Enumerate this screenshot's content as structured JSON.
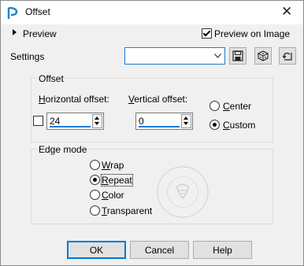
{
  "window": {
    "title": "Offset",
    "close_glyph": "✕"
  },
  "top": {
    "preview_label": "Preview",
    "preview_on_image_label": "Preview on Image",
    "preview_on_image_checked": true,
    "settings_label": "Settings",
    "settings_value": ""
  },
  "offset": {
    "group_title": "Offset",
    "horizontal_label_ul": "H",
    "horizontal_label_rest": "orizontal offset:",
    "vertical_label_ul": "V",
    "vertical_label_rest": "ertical offset:",
    "horizontal_value": "24",
    "vertical_value": "0",
    "link_checked": false,
    "center_label_ul": "C",
    "center_label_rest": "enter",
    "custom_label_ul": "C",
    "custom_label_rest": "ustom",
    "selected": "custom"
  },
  "edge_mode": {
    "group_title": "Edge mode",
    "wrap_ul": "W",
    "wrap_rest": "rap",
    "repeat_ul": "R",
    "repeat_rest": "epeat",
    "color_ul": "C",
    "color_rest": "olor",
    "transparent_ul": "T",
    "transparent_rest": "ransparent",
    "selected": "repeat"
  },
  "buttons": {
    "ok": "OK",
    "cancel": "Cancel",
    "help": "Help"
  },
  "icons": [
    "app-icon",
    "close-icon",
    "expand-triangle-icon",
    "dropdown-arrow-icon",
    "save-preset-icon",
    "randomize-icon",
    "reset-icon",
    "spin-up-icon",
    "spin-down-icon"
  ],
  "colors": {
    "accent": "#1c7bd6",
    "dialog_bg": "#f0f0f0",
    "titlebar_bg": "#ffffff",
    "button_bg": "#e1e1e1"
  }
}
